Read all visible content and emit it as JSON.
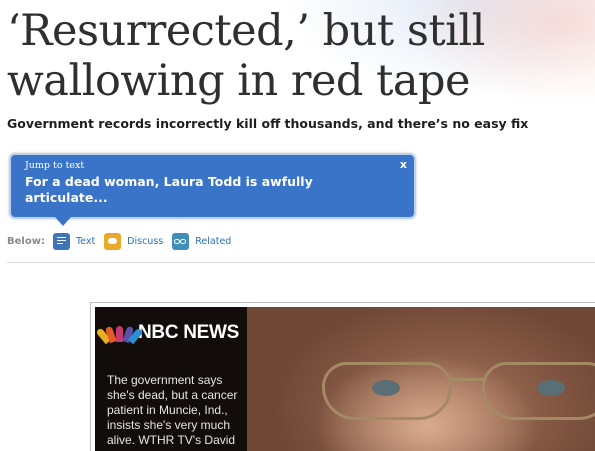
{
  "article": {
    "headline": "‘Resurrected,’ but still wallowing in red tape",
    "subhead": "Government records incorrectly kill off thousands, and there’s no easy fix"
  },
  "jump_box": {
    "label": "Jump to text",
    "close": "x",
    "text": "For a dead woman, Laura Todd is awfully articulate..."
  },
  "below": {
    "label": "Below:",
    "links": [
      {
        "label": "Text",
        "icon": "text-icon"
      },
      {
        "label": "Discuss",
        "icon": "discuss-icon"
      },
      {
        "label": "Related",
        "icon": "related-icon"
      }
    ]
  },
  "video": {
    "logo_text": "NBC NEWS",
    "caption": "The government says she's dead, but a cancer patient in Muncie, Ind., insists she's very much alive. WTHR TV's David"
  },
  "colors": {
    "jump_box_bg": "#3a74c9",
    "link": "#2a6fb6",
    "headline": "#2f2f2f"
  }
}
